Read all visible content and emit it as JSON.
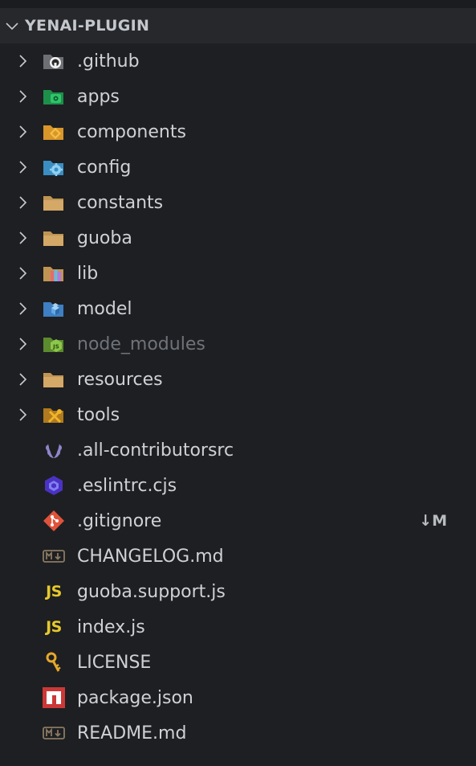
{
  "explorer": {
    "section_title": "YENAI-PLUGIN",
    "folders": [
      {
        "label": ".github",
        "icon": "github-folder-icon"
      },
      {
        "label": "apps",
        "icon": "apps-folder-icon"
      },
      {
        "label": "components",
        "icon": "components-folder-icon"
      },
      {
        "label": "config",
        "icon": "config-folder-icon"
      },
      {
        "label": "constants",
        "icon": "folder-icon"
      },
      {
        "label": "guoba",
        "icon": "folder-icon"
      },
      {
        "label": "lib",
        "icon": "lib-folder-icon"
      },
      {
        "label": "model",
        "icon": "model-folder-icon"
      },
      {
        "label": "node_modules",
        "icon": "node-folder-icon",
        "dimmed": true
      },
      {
        "label": "resources",
        "icon": "folder-icon"
      },
      {
        "label": "tools",
        "icon": "tools-folder-icon"
      }
    ],
    "files": [
      {
        "label": ".all-contributorsrc",
        "icon": "laurel-icon"
      },
      {
        "label": ".eslintrc.cjs",
        "icon": "eslint-icon"
      },
      {
        "label": ".gitignore",
        "icon": "git-icon",
        "badge": "↓M"
      },
      {
        "label": "CHANGELOG.md",
        "icon": "markdown-icon"
      },
      {
        "label": "guoba.support.js",
        "icon": "js-icon",
        "glyph": "JS"
      },
      {
        "label": "index.js",
        "icon": "js-icon",
        "glyph": "JS"
      },
      {
        "label": "LICENSE",
        "icon": "key-icon"
      },
      {
        "label": "package.json",
        "icon": "npm-icon"
      },
      {
        "label": "README.md",
        "icon": "markdown-icon"
      }
    ]
  },
  "colors": {
    "background": "#1e1f22",
    "header_background": "#26282c",
    "folder": "#c09553",
    "js_yellow": "#e7c92c"
  }
}
